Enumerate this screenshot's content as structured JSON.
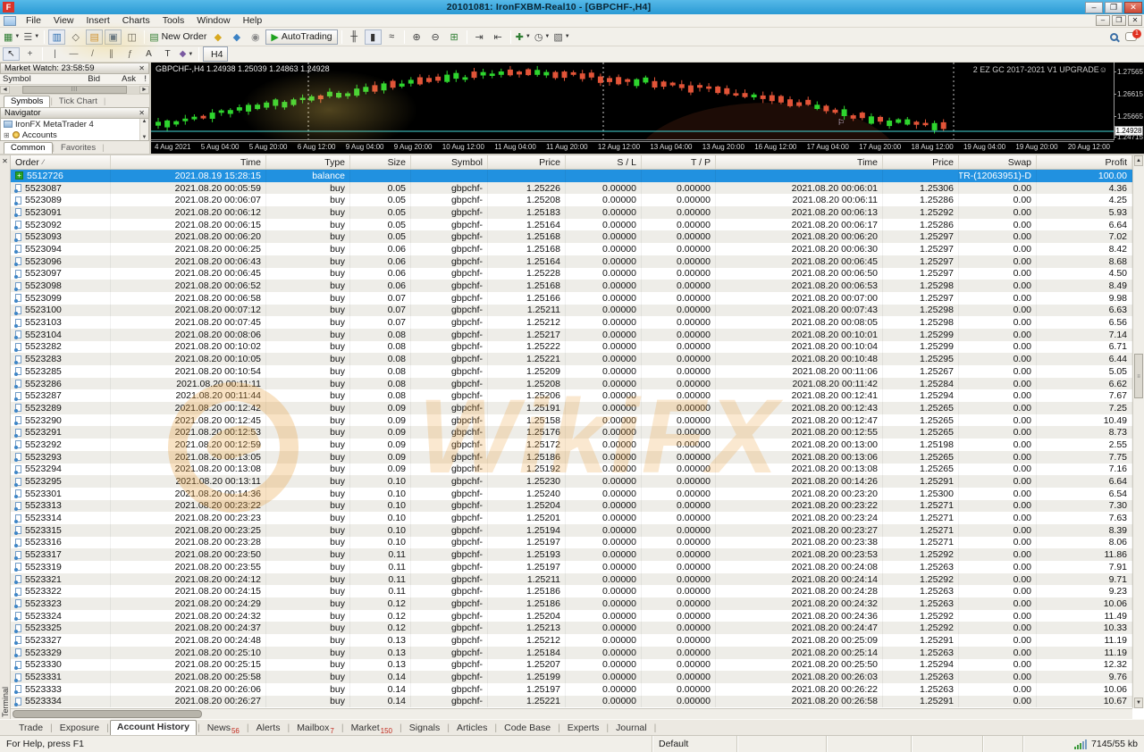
{
  "window": {
    "title": "20101081: IronFXBM-Real10 - [GBPCHF-,H4]",
    "controls": {
      "minimize": "–",
      "restore": "❐",
      "close": "✕"
    }
  },
  "menus": [
    "File",
    "View",
    "Insert",
    "Charts",
    "Tools",
    "Window",
    "Help"
  ],
  "toolbar": {
    "notification_count": "1",
    "row1": [
      {
        "name": "new-chart-button",
        "glyph": "▦",
        "color": "#2e7d32",
        "caret": true
      },
      {
        "name": "profiles-button",
        "glyph": "☰",
        "color": "#5a5a5a",
        "caret": true
      },
      {
        "sep": true
      },
      {
        "name": "market-watch-toggle",
        "glyph": "▥",
        "color": "#2b6cb0",
        "pressed": true
      },
      {
        "name": "data-window-toggle",
        "glyph": "◇",
        "color": "#555555"
      },
      {
        "name": "navigator-toggle",
        "glyph": "▤",
        "color": "#c9872a",
        "pressed": true
      },
      {
        "name": "terminal-toggle",
        "glyph": "▣",
        "color": "#49648c",
        "pressed": true
      },
      {
        "name": "strategy-tester-toggle",
        "glyph": "◫",
        "color": "#555555"
      },
      {
        "sep": true
      },
      {
        "name": "new-order-button",
        "glyph": "▤",
        "color": "#2e7d32",
        "label": "New Order"
      },
      {
        "name": "metaeditor-button",
        "glyph": "◆",
        "color": "#d8a81e"
      },
      {
        "name": "experts-button",
        "glyph": "◆",
        "color": "#3b82c4"
      },
      {
        "name": "sounds-button",
        "glyph": "◉",
        "color": "#888888"
      },
      {
        "name": "autotrading-button",
        "glyph": "▶",
        "color": "#1fa21f",
        "label": "AutoTrading",
        "boxed": true
      },
      {
        "sep": true
      },
      {
        "name": "bar-chart-mode-button",
        "glyph": "╫",
        "color": "#333333"
      },
      {
        "name": "candlestick-mode-button",
        "glyph": "▮",
        "color": "#333333",
        "pressed": true
      },
      {
        "name": "line-chart-mode-button",
        "glyph": "≈",
        "color": "#333333"
      },
      {
        "sep": true
      },
      {
        "name": "zoom-in-button",
        "glyph": "⊕",
        "color": "#444444"
      },
      {
        "name": "zoom-out-button",
        "glyph": "⊖",
        "color": "#444444"
      },
      {
        "name": "tile-windows-button",
        "glyph": "⊞",
        "color": "#2e7d32"
      },
      {
        "sep": true
      },
      {
        "name": "auto-scroll-button",
        "glyph": "⇥",
        "color": "#444444"
      },
      {
        "name": "chart-shift-button",
        "glyph": "⇤",
        "color": "#444444"
      },
      {
        "sep": true
      },
      {
        "name": "indicators-button",
        "glyph": "✚",
        "color": "#2e7d32",
        "caret": true
      },
      {
        "name": "periods-button",
        "glyph": "◷",
        "color": "#444444",
        "caret": true
      },
      {
        "name": "templates-button",
        "glyph": "▧",
        "color": "#555555",
        "caret": true
      }
    ],
    "row2": [
      {
        "name": "cursor-tool",
        "glyph": "↖",
        "color": "#222222",
        "pressed": true
      },
      {
        "name": "crosshair-tool",
        "glyph": "+",
        "color": "#555555"
      },
      {
        "sep": true
      },
      {
        "name": "vertical-line-tool",
        "glyph": "|",
        "color": "#555555"
      },
      {
        "name": "horizontal-line-tool",
        "glyph": "—",
        "color": "#555555"
      },
      {
        "name": "trendline-tool",
        "glyph": "/",
        "color": "#555555"
      },
      {
        "name": "channel-tool",
        "glyph": "∥",
        "color": "#555555"
      },
      {
        "name": "fibonacci-tool",
        "glyph": "ƒ",
        "color": "#555555"
      },
      {
        "name": "text-tool",
        "glyph": "A",
        "color": "#333333"
      },
      {
        "name": "label-tool",
        "glyph": "T",
        "color": "#333333"
      },
      {
        "name": "arrows-tool",
        "glyph": "◆",
        "color": "#7a5aa0",
        "caret": true
      },
      {
        "sep": true
      },
      {
        "name": "period-h4-button",
        "label": "H4",
        "boxed": true,
        "pressed": true
      }
    ]
  },
  "market_watch": {
    "title": "Market Watch: 23:58:59",
    "columns": [
      "Symbol",
      "Bid",
      "Ask",
      "!"
    ],
    "tabs": [
      "Symbols",
      "Tick Chart"
    ]
  },
  "navigator": {
    "title": "Navigator",
    "items": [
      "IronFX MetaTrader 4",
      "Accounts"
    ],
    "tabs": [
      "Common",
      "Favorites"
    ]
  },
  "chart": {
    "symbol_info": "GBPCHF-,H4  1.24938 1.25039 1.24863 1.24928",
    "overlay_label": "2 EZ GC 2017-2021 V1 UPGRADE☺",
    "price_labels": [
      "1.27565",
      "1.26615",
      "1.25665",
      "1.24928",
      "1.24715"
    ],
    "current_price": "1.24928",
    "time_labels": [
      "4 Aug 2021",
      "5 Aug 04:00",
      "5 Aug 20:00",
      "6 Aug 12:00",
      "9 Aug 04:00",
      "9 Aug 20:00",
      "10 Aug 12:00",
      "11 Aug 04:00",
      "11 Aug 20:00",
      "12 Aug 12:00",
      "13 Aug 04:00",
      "13 Aug 20:00",
      "16 Aug 12:00",
      "17 Aug 04:00",
      "17 Aug 20:00",
      "18 Aug 12:00",
      "19 Aug 04:00",
      "19 Aug 20:00",
      "20 Aug 12:00"
    ],
    "candle_count": 88,
    "trend": [
      [
        0,
        0.88
      ],
      [
        0.04,
        0.8
      ],
      [
        0.1,
        0.66
      ],
      [
        0.17,
        0.54
      ],
      [
        0.24,
        0.4
      ],
      [
        0.31,
        0.27
      ],
      [
        0.38,
        0.16
      ],
      [
        0.45,
        0.11
      ],
      [
        0.52,
        0.12
      ],
      [
        0.58,
        0.18
      ],
      [
        0.64,
        0.26
      ],
      [
        0.7,
        0.34
      ],
      [
        0.76,
        0.44
      ],
      [
        0.82,
        0.55
      ],
      [
        0.87,
        0.7
      ],
      [
        0.91,
        0.82
      ],
      [
        0.95,
        0.88
      ],
      [
        1,
        0.9
      ]
    ],
    "colors": {
      "up": "#2ed52e",
      "down": "#e25438",
      "current_line": "#45d8d8"
    }
  },
  "history": {
    "columns": [
      "Order",
      "Time",
      "Type",
      "Size",
      "Symbol",
      "Price",
      "S / L",
      "T / P",
      "Time",
      "Price",
      "Swap",
      "Profit"
    ],
    "sort_indicator": "∕",
    "rows": [
      [
        "5512726",
        "2021.08.19 15:28:15",
        "balance",
        "",
        "",
        "",
        "",
        "",
        "",
        "",
        "TR-(12063951)-D",
        "100.00"
      ],
      [
        "5523087",
        "2021.08.20 00:05:59",
        "buy",
        "0.05",
        "gbpchf-",
        "1.25226",
        "0.00000",
        "0.00000",
        "2021.08.20 00:06:01",
        "1.25306",
        "0.00",
        "4.36"
      ],
      [
        "5523089",
        "2021.08.20 00:06:07",
        "buy",
        "0.05",
        "gbpchf-",
        "1.25208",
        "0.00000",
        "0.00000",
        "2021.08.20 00:06:11",
        "1.25286",
        "0.00",
        "4.25"
      ],
      [
        "5523091",
        "2021.08.20 00:06:12",
        "buy",
        "0.05",
        "gbpchf-",
        "1.25183",
        "0.00000",
        "0.00000",
        "2021.08.20 00:06:13",
        "1.25292",
        "0.00",
        "5.93"
      ],
      [
        "5523092",
        "2021.08.20 00:06:15",
        "buy",
        "0.05",
        "gbpchf-",
        "1.25164",
        "0.00000",
        "0.00000",
        "2021.08.20 00:06:17",
        "1.25286",
        "0.00",
        "6.64"
      ],
      [
        "5523093",
        "2021.08.20 00:06:20",
        "buy",
        "0.05",
        "gbpchf-",
        "1.25168",
        "0.00000",
        "0.00000",
        "2021.08.20 00:06:20",
        "1.25297",
        "0.00",
        "7.02"
      ],
      [
        "5523094",
        "2021.08.20 00:06:25",
        "buy",
        "0.06",
        "gbpchf-",
        "1.25168",
        "0.00000",
        "0.00000",
        "2021.08.20 00:06:30",
        "1.25297",
        "0.00",
        "8.42"
      ],
      [
        "5523096",
        "2021.08.20 00:06:43",
        "buy",
        "0.06",
        "gbpchf-",
        "1.25164",
        "0.00000",
        "0.00000",
        "2021.08.20 00:06:45",
        "1.25297",
        "0.00",
        "8.68"
      ],
      [
        "5523097",
        "2021.08.20 00:06:45",
        "buy",
        "0.06",
        "gbpchf-",
        "1.25228",
        "0.00000",
        "0.00000",
        "2021.08.20 00:06:50",
        "1.25297",
        "0.00",
        "4.50"
      ],
      [
        "5523098",
        "2021.08.20 00:06:52",
        "buy",
        "0.06",
        "gbpchf-",
        "1.25168",
        "0.00000",
        "0.00000",
        "2021.08.20 00:06:53",
        "1.25298",
        "0.00",
        "8.49"
      ],
      [
        "5523099",
        "2021.08.20 00:06:58",
        "buy",
        "0.07",
        "gbpchf-",
        "1.25166",
        "0.00000",
        "0.00000",
        "2021.08.20 00:07:00",
        "1.25297",
        "0.00",
        "9.98"
      ],
      [
        "5523100",
        "2021.08.20 00:07:12",
        "buy",
        "0.07",
        "gbpchf-",
        "1.25211",
        "0.00000",
        "0.00000",
        "2021.08.20 00:07:43",
        "1.25298",
        "0.00",
        "6.63"
      ],
      [
        "5523103",
        "2021.08.20 00:07:45",
        "buy",
        "0.07",
        "gbpchf-",
        "1.25212",
        "0.00000",
        "0.00000",
        "2021.08.20 00:08:05",
        "1.25298",
        "0.00",
        "6.56"
      ],
      [
        "5523104",
        "2021.08.20 00:08:06",
        "buy",
        "0.08",
        "gbpchf-",
        "1.25217",
        "0.00000",
        "0.00000",
        "2021.08.20 00:10:01",
        "1.25299",
        "0.00",
        "7.14"
      ],
      [
        "5523282",
        "2021.08.20 00:10:02",
        "buy",
        "0.08",
        "gbpchf-",
        "1.25222",
        "0.00000",
        "0.00000",
        "2021.08.20 00:10:04",
        "1.25299",
        "0.00",
        "6.71"
      ],
      [
        "5523283",
        "2021.08.20 00:10:05",
        "buy",
        "0.08",
        "gbpchf-",
        "1.25221",
        "0.00000",
        "0.00000",
        "2021.08.20 00:10:48",
        "1.25295",
        "0.00",
        "6.44"
      ],
      [
        "5523285",
        "2021.08.20 00:10:54",
        "buy",
        "0.08",
        "gbpchf-",
        "1.25209",
        "0.00000",
        "0.00000",
        "2021.08.20 00:11:06",
        "1.25267",
        "0.00",
        "5.05"
      ],
      [
        "5523286",
        "2021.08.20 00:11:11",
        "buy",
        "0.08",
        "gbpchf-",
        "1.25208",
        "0.00000",
        "0.00000",
        "2021.08.20 00:11:42",
        "1.25284",
        "0.00",
        "6.62"
      ],
      [
        "5523287",
        "2021.08.20 00:11:44",
        "buy",
        "0.08",
        "gbpchf-",
        "1.25206",
        "0.00000",
        "0.00000",
        "2021.08.20 00:12:41",
        "1.25294",
        "0.00",
        "7.67"
      ],
      [
        "5523289",
        "2021.08.20 00:12:42",
        "buy",
        "0.09",
        "gbpchf-",
        "1.25191",
        "0.00000",
        "0.00000",
        "2021.08.20 00:12:43",
        "1.25265",
        "0.00",
        "7.25"
      ],
      [
        "5523290",
        "2021.08.20 00:12:45",
        "buy",
        "0.09",
        "gbpchf-",
        "1.25158",
        "0.00000",
        "0.00000",
        "2021.08.20 00:12:47",
        "1.25265",
        "0.00",
        "10.49"
      ],
      [
        "5523291",
        "2021.08.20 00:12:53",
        "buy",
        "0.09",
        "gbpchf-",
        "1.25176",
        "0.00000",
        "0.00000",
        "2021.08.20 00:12:55",
        "1.25265",
        "0.00",
        "8.73"
      ],
      [
        "5523292",
        "2021.08.20 00:12:59",
        "buy",
        "0.09",
        "gbpchf-",
        "1.25172",
        "0.00000",
        "0.00000",
        "2021.08.20 00:13:00",
        "1.25198",
        "0.00",
        "2.55"
      ],
      [
        "5523293",
        "2021.08.20 00:13:05",
        "buy",
        "0.09",
        "gbpchf-",
        "1.25186",
        "0.00000",
        "0.00000",
        "2021.08.20 00:13:06",
        "1.25265",
        "0.00",
        "7.75"
      ],
      [
        "5523294",
        "2021.08.20 00:13:08",
        "buy",
        "0.09",
        "gbpchf-",
        "1.25192",
        "0.00000",
        "0.00000",
        "2021.08.20 00:13:08",
        "1.25265",
        "0.00",
        "7.16"
      ],
      [
        "5523295",
        "2021.08.20 00:13:11",
        "buy",
        "0.10",
        "gbpchf-",
        "1.25230",
        "0.00000",
        "0.00000",
        "2021.08.20 00:14:26",
        "1.25291",
        "0.00",
        "6.64"
      ],
      [
        "5523301",
        "2021.08.20 00:14:36",
        "buy",
        "0.10",
        "gbpchf-",
        "1.25240",
        "0.00000",
        "0.00000",
        "2021.08.20 00:23:20",
        "1.25300",
        "0.00",
        "6.54"
      ],
      [
        "5523313",
        "2021.08.20 00:23:22",
        "buy",
        "0.10",
        "gbpchf-",
        "1.25204",
        "0.00000",
        "0.00000",
        "2021.08.20 00:23:22",
        "1.25271",
        "0.00",
        "7.30"
      ],
      [
        "5523314",
        "2021.08.20 00:23:23",
        "buy",
        "0.10",
        "gbpchf-",
        "1.25201",
        "0.00000",
        "0.00000",
        "2021.08.20 00:23:24",
        "1.25271",
        "0.00",
        "7.63"
      ],
      [
        "5523315",
        "2021.08.20 00:23:25",
        "buy",
        "0.10",
        "gbpchf-",
        "1.25194",
        "0.00000",
        "0.00000",
        "2021.08.20 00:23:27",
        "1.25271",
        "0.00",
        "8.39"
      ],
      [
        "5523316",
        "2021.08.20 00:23:28",
        "buy",
        "0.10",
        "gbpchf-",
        "1.25197",
        "0.00000",
        "0.00000",
        "2021.08.20 00:23:38",
        "1.25271",
        "0.00",
        "8.06"
      ],
      [
        "5523317",
        "2021.08.20 00:23:50",
        "buy",
        "0.11",
        "gbpchf-",
        "1.25193",
        "0.00000",
        "0.00000",
        "2021.08.20 00:23:53",
        "1.25292",
        "0.00",
        "11.86"
      ],
      [
        "5523319",
        "2021.08.20 00:23:55",
        "buy",
        "0.11",
        "gbpchf-",
        "1.25197",
        "0.00000",
        "0.00000",
        "2021.08.20 00:24:08",
        "1.25263",
        "0.00",
        "7.91"
      ],
      [
        "5523321",
        "2021.08.20 00:24:12",
        "buy",
        "0.11",
        "gbpchf-",
        "1.25211",
        "0.00000",
        "0.00000",
        "2021.08.20 00:24:14",
        "1.25292",
        "0.00",
        "9.71"
      ],
      [
        "5523322",
        "2021.08.20 00:24:15",
        "buy",
        "0.11",
        "gbpchf-",
        "1.25186",
        "0.00000",
        "0.00000",
        "2021.08.20 00:24:28",
        "1.25263",
        "0.00",
        "9.23"
      ],
      [
        "5523323",
        "2021.08.20 00:24:29",
        "buy",
        "0.12",
        "gbpchf-",
        "1.25186",
        "0.00000",
        "0.00000",
        "2021.08.20 00:24:32",
        "1.25263",
        "0.00",
        "10.06"
      ],
      [
        "5523324",
        "2021.08.20 00:24:32",
        "buy",
        "0.12",
        "gbpchf-",
        "1.25204",
        "0.00000",
        "0.00000",
        "2021.08.20 00:24:36",
        "1.25292",
        "0.00",
        "11.49"
      ],
      [
        "5523325",
        "2021.08.20 00:24:37",
        "buy",
        "0.12",
        "gbpchf-",
        "1.25213",
        "0.00000",
        "0.00000",
        "2021.08.20 00:24:47",
        "1.25292",
        "0.00",
        "10.33"
      ],
      [
        "5523327",
        "2021.08.20 00:24:48",
        "buy",
        "0.13",
        "gbpchf-",
        "1.25212",
        "0.00000",
        "0.00000",
        "2021.08.20 00:25:09",
        "1.25291",
        "0.00",
        "11.19"
      ],
      [
        "5523329",
        "2021.08.20 00:25:10",
        "buy",
        "0.13",
        "gbpchf-",
        "1.25184",
        "0.00000",
        "0.00000",
        "2021.08.20 00:25:14",
        "1.25263",
        "0.00",
        "11.19"
      ],
      [
        "5523330",
        "2021.08.20 00:25:15",
        "buy",
        "0.13",
        "gbpchf-",
        "1.25207",
        "0.00000",
        "0.00000",
        "2021.08.20 00:25:50",
        "1.25294",
        "0.00",
        "12.32"
      ],
      [
        "5523331",
        "2021.08.20 00:25:58",
        "buy",
        "0.14",
        "gbpchf-",
        "1.25199",
        "0.00000",
        "0.00000",
        "2021.08.20 00:26:03",
        "1.25263",
        "0.00",
        "9.76"
      ],
      [
        "5523333",
        "2021.08.20 00:26:06",
        "buy",
        "0.14",
        "gbpchf-",
        "1.25197",
        "0.00000",
        "0.00000",
        "2021.08.20 00:26:22",
        "1.25263",
        "0.00",
        "10.06"
      ],
      [
        "5523334",
        "2021.08.20 00:26:27",
        "buy",
        "0.14",
        "gbpchf-",
        "1.25221",
        "0.00000",
        "0.00000",
        "2021.08.20 00:26:58",
        "1.25291",
        "0.00",
        "10.67"
      ]
    ]
  },
  "bottom_tabs": [
    {
      "label": "Trade"
    },
    {
      "label": "Exposure"
    },
    {
      "label": "Account History",
      "active": true
    },
    {
      "label": "News",
      "badge": "56"
    },
    {
      "label": "Alerts"
    },
    {
      "label": "Mailbox",
      "badge": "7"
    },
    {
      "label": "Market",
      "badge": "150"
    },
    {
      "label": "Signals"
    },
    {
      "label": "Articles"
    },
    {
      "label": "Code Base"
    },
    {
      "label": "Experts"
    },
    {
      "label": "Journal"
    }
  ],
  "status_bar": {
    "help": "For Help, press F1",
    "profile": "Default",
    "connection": "7145/55 kb"
  },
  "watermark": {
    "text": "WikiFX"
  }
}
